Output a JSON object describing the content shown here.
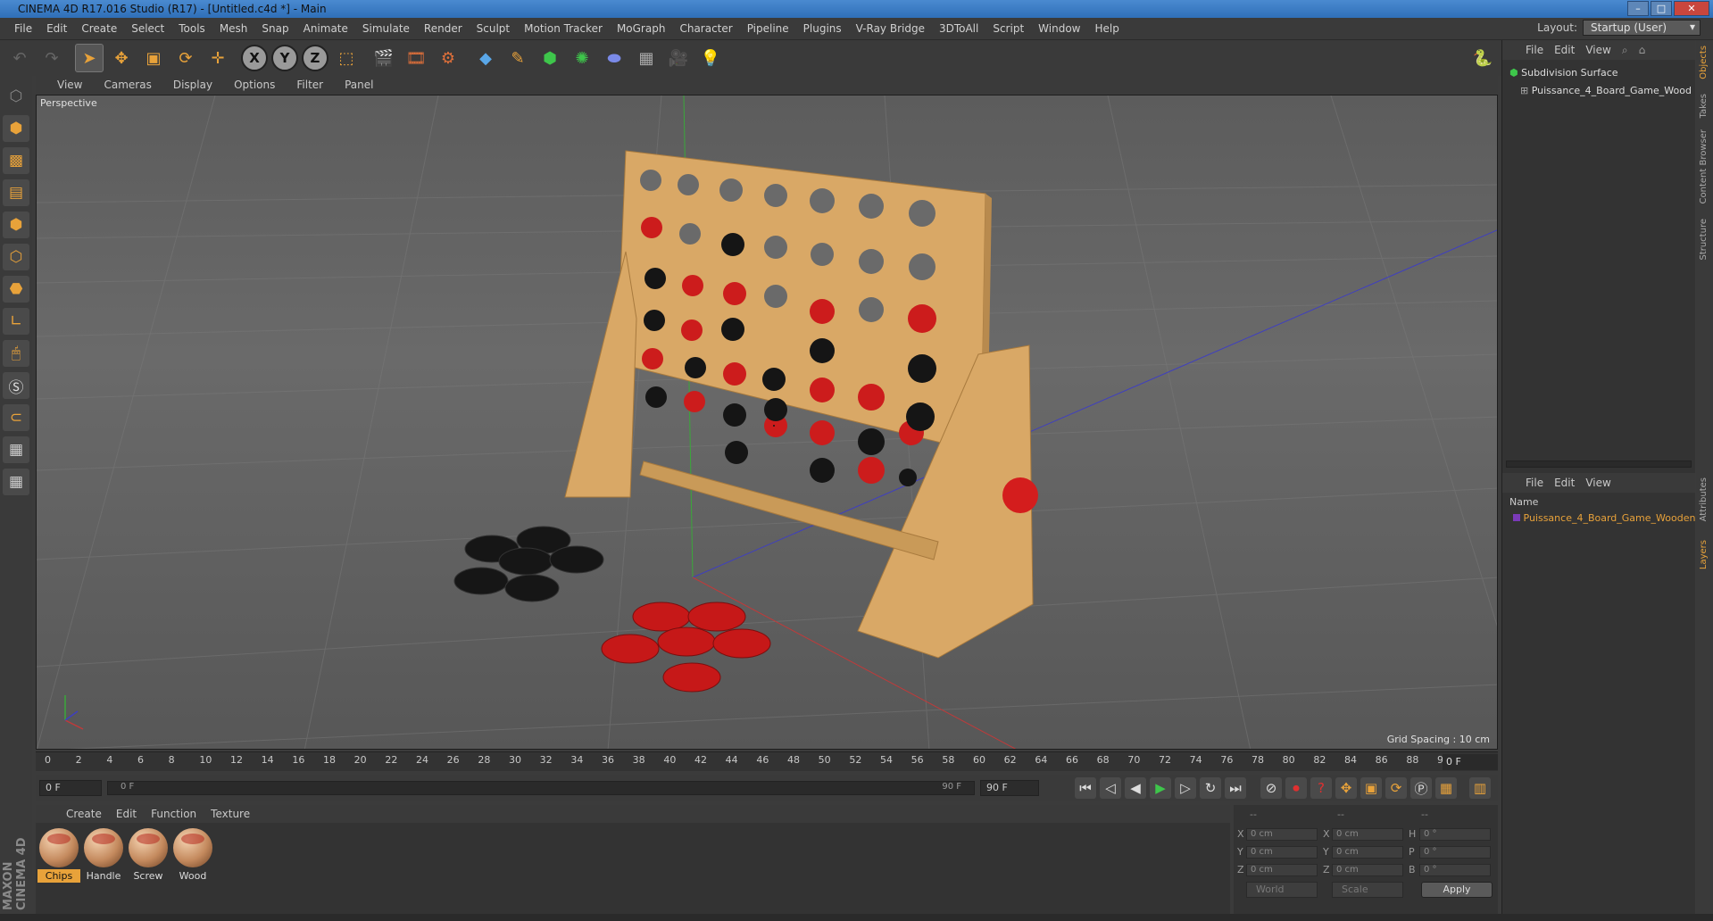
{
  "window": {
    "title": "CINEMA 4D R17.016 Studio (R17) - [Untitled.c4d *] - Main"
  },
  "menu": [
    "File",
    "Edit",
    "Create",
    "Select",
    "Tools",
    "Mesh",
    "Snap",
    "Animate",
    "Simulate",
    "Render",
    "Sculpt",
    "Motion Tracker",
    "MoGraph",
    "Character",
    "Pipeline",
    "Plugins",
    "V-Ray Bridge",
    "3DToAll",
    "Script",
    "Window",
    "Help"
  ],
  "layout": {
    "label": "Layout:",
    "value": "Startup (User)"
  },
  "toolbar": {
    "axes": [
      "X",
      "Y",
      "Z"
    ]
  },
  "viewport": {
    "menu": [
      "View",
      "Cameras",
      "Display",
      "Options",
      "Filter",
      "Panel"
    ],
    "label": "Perspective",
    "grid_spacing": "Grid Spacing : 10 cm"
  },
  "timeline": {
    "ticks": [
      "0",
      "2",
      "4",
      "6",
      "8",
      "10",
      "12",
      "14",
      "16",
      "18",
      "20",
      "22",
      "24",
      "26",
      "28",
      "30",
      "32",
      "34",
      "36",
      "38",
      "40",
      "42",
      "44",
      "46",
      "48",
      "50",
      "52",
      "54",
      "56",
      "58",
      "60",
      "62",
      "64",
      "66",
      "68",
      "70",
      "72",
      "74",
      "76",
      "78",
      "80",
      "82",
      "84",
      "86",
      "88",
      "90"
    ],
    "current": "0 F",
    "start": "0 F",
    "range_start": "0 F",
    "range_end": "90 F",
    "end": "90 F"
  },
  "materials": {
    "menu": [
      "Create",
      "Edit",
      "Function",
      "Texture"
    ],
    "items": [
      {
        "name": "Chips",
        "active": true
      },
      {
        "name": "Handle",
        "active": false
      },
      {
        "name": "Screw",
        "active": false
      },
      {
        "name": "Wood",
        "active": false
      }
    ]
  },
  "coords": {
    "header": [
      "--",
      "--",
      "--"
    ],
    "rows": [
      {
        "a": "X",
        "v1": "0 cm",
        "b": "X",
        "v2": "0 cm",
        "c": "H",
        "v3": "0 °"
      },
      {
        "a": "Y",
        "v1": "0 cm",
        "b": "Y",
        "v2": "0 cm",
        "c": "P",
        "v3": "0 °"
      },
      {
        "a": "Z",
        "v1": "0 cm",
        "b": "Z",
        "v2": "0 cm",
        "c": "B",
        "v3": "0 °"
      }
    ],
    "mode1": "World",
    "mode2": "Scale",
    "apply": "Apply"
  },
  "objects": {
    "menu": [
      "File",
      "Edit",
      "View"
    ],
    "items": [
      {
        "name": "Subdivision Surface",
        "color": "#ffffff"
      },
      {
        "name": "Puissance_4_Board_Game_Wood",
        "color": "#dddddd"
      }
    ]
  },
  "layers": {
    "menu": [
      "File",
      "Edit",
      "View"
    ],
    "column": "Name",
    "items": [
      {
        "name": "Puissance_4_Board_Game_Wooden",
        "color": "#e8a23a"
      }
    ]
  },
  "right_tabs": [
    "Objects",
    "Takes",
    "Content Browser",
    "Structure",
    "Attributes",
    "Layers"
  ],
  "branding": "MAXON CINEMA 4D"
}
